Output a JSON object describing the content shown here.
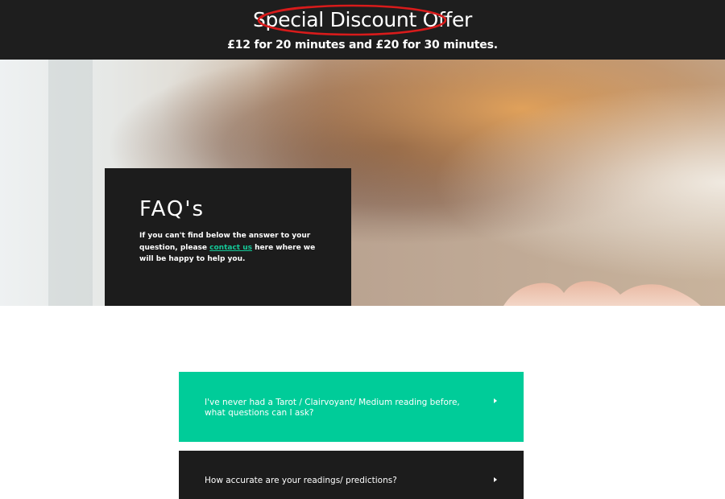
{
  "offer": {
    "title": "Special Discount Offer",
    "subtitle": "£12 for 20 minutes and £20 for 30 minutes.",
    "highlight_color": "#d81b1b"
  },
  "faq_panel": {
    "heading": "FAQ's",
    "intro_before": "If you can't find below the answer to your question, please ",
    "intro_link": "contact us",
    "intro_after": " here where we will be happy to help you."
  },
  "faq_items": [
    {
      "question": "I've never had a Tarot / Clairvoyant/ Medium reading before, what questions can I ask?",
      "icon": "caret-right-icon",
      "state": "highlighted"
    },
    {
      "question": "How accurate are your readings/ predictions?",
      "icon": "caret-right-icon",
      "state": "collapsed"
    }
  ],
  "colors": {
    "banner_bg": "#1e1e1e",
    "accent": "#00cc99",
    "link": "#14c998",
    "panel_bg": "#1c1c1c"
  }
}
